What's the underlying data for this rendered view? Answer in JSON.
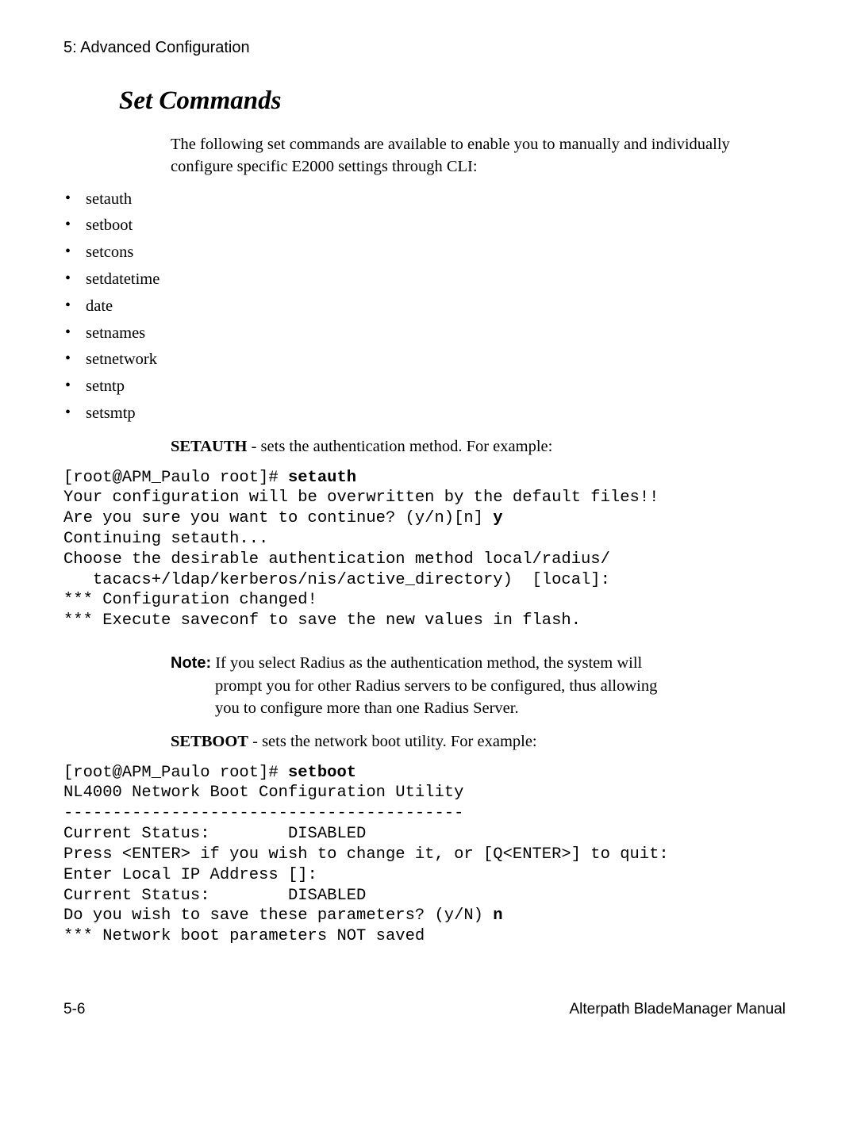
{
  "header": {
    "chapter": "5: Advanced Configuration"
  },
  "section": {
    "heading": "Set Commands",
    "intro": "The following set commands are available to enable you to manually and individually configure specific E2000 settings through CLI:",
    "bullets": [
      "setauth",
      "setboot",
      "setcons",
      "setdatetime",
      "date",
      "setnames",
      "setnetwork",
      "setntp",
      "setsmtp"
    ]
  },
  "setauth": {
    "name": "SETAUTH",
    "desc": " - sets the authentication method. For example:",
    "code_prompt": "[root@APM_Paulo root]# ",
    "code_cmd": "setauth",
    "code_line2": "Your configuration will be overwritten by the default files!!",
    "code_line3a": "Are you sure you want to continue? (y/n)[n] ",
    "code_line3b": "y",
    "code_line4": "Continuing setauth...",
    "code_line5": "Choose the desirable authentication method local/radius/",
    "code_line6": "   tacacs+/ldap/kerberos/nis/active_directory)  [local]:",
    "code_line7": "*** Configuration changed!",
    "code_line8": "*** Execute saveconf to save the new values in flash."
  },
  "note": {
    "label": "Note:",
    "text_first": " If you select Radius as the authentication method, the system will",
    "text_cont1": "prompt you for other Radius servers to be configured, thus allowing",
    "text_cont2": "you to configure more than one Radius Server."
  },
  "setboot": {
    "name": "SETBOOT",
    "desc": " - sets the network boot utility. For example:",
    "code_prompt": "[root@APM_Paulo root]# ",
    "code_cmd": "setboot",
    "code_line2": "NL4000 Network Boot Configuration Utility",
    "code_line3": "-----------------------------------------",
    "code_line4": "Current Status:        DISABLED",
    "code_line5": "Press <ENTER> if you wish to change it, or [Q<ENTER>] to quit:",
    "code_line6": "Enter Local IP Address []:",
    "code_line7": "Current Status:        DISABLED",
    "code_line8a": "Do you wish to save these parameters? (y/N) ",
    "code_line8b": "n",
    "code_line9": "*** Network boot parameters NOT saved"
  },
  "footer": {
    "page": "5-6",
    "manual": "Alterpath BladeManager Manual"
  }
}
